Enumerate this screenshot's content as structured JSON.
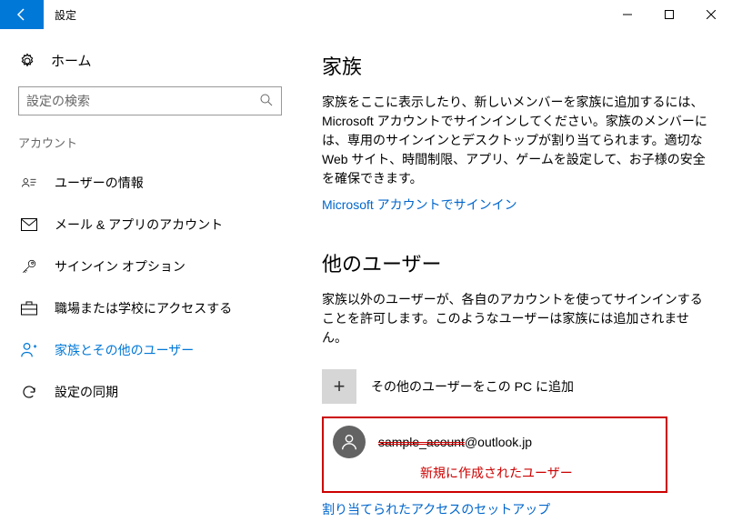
{
  "titlebar": {
    "title": "設定"
  },
  "sidebar": {
    "home": "ホーム",
    "search_placeholder": "設定の検索",
    "section": "アカウント",
    "items": [
      {
        "label": "ユーザーの情報"
      },
      {
        "label": "メール & アプリのアカウント"
      },
      {
        "label": "サインイン オプション"
      },
      {
        "label": "職場または学校にアクセスする"
      },
      {
        "label": "家族とその他のユーザー"
      },
      {
        "label": "設定の同期"
      }
    ]
  },
  "main": {
    "family": {
      "heading": "家族",
      "body": "家族をここに表示したり、新しいメンバーを家族に追加するには、Microsoft アカウントでサインインしてください。家族のメンバーには、専用のサインインとデスクトップが割り当てられます。適切な Web サイト、時間制限、アプリ、ゲームを設定して、お子様の安全を確保できます。",
      "signin_link": "Microsoft アカウントでサインイン"
    },
    "others": {
      "heading": "他のユーザー",
      "body": "家族以外のユーザーが、各自のアカウントを使ってサインインすることを許可します。このようなユーザーは家族には追加されません。",
      "add_label": "その他のユーザーをこの PC に追加",
      "user_masked": "sample_acount",
      "user_domain": "@outlook.jp",
      "annotation": "新規に作成されたユーザー",
      "access_link": "割り当てられたアクセスのセットアップ"
    }
  }
}
